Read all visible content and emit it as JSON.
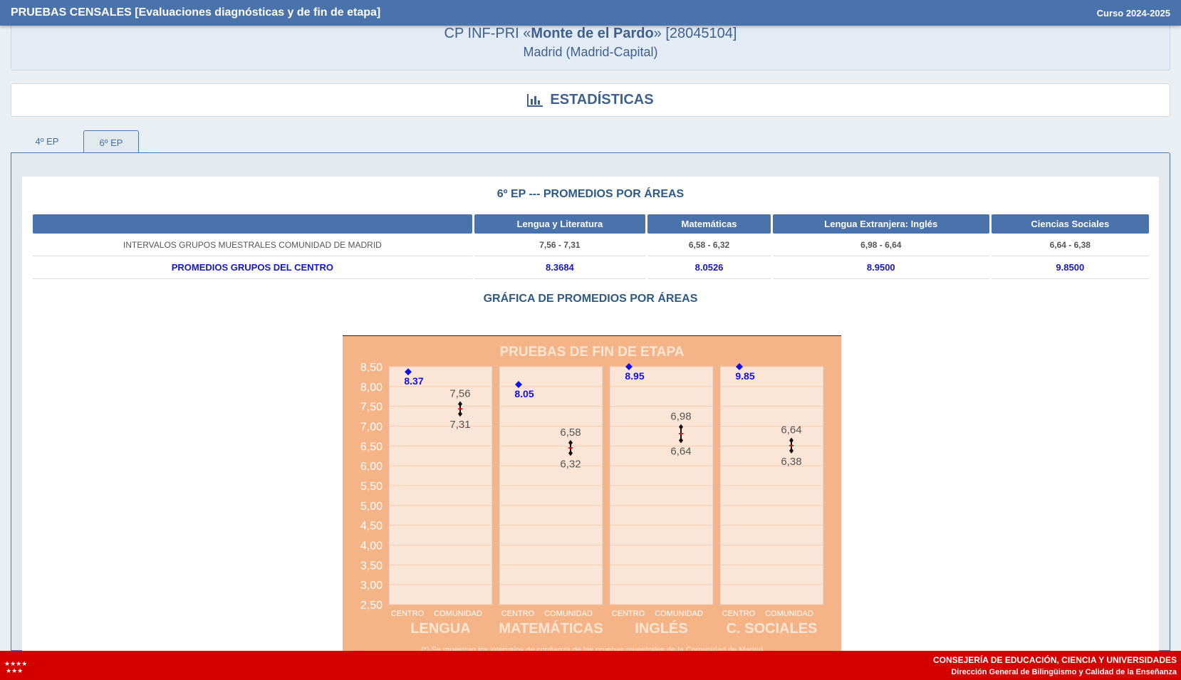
{
  "topbar": {
    "title": "PRUEBAS CENSALES [Evaluaciones diagnósticas y de fin de etapa]",
    "course": "Curso 2024-2025"
  },
  "school": {
    "prefix": "CP INF-PRI «",
    "name": "Monte de el Pardo",
    "suffix": "» [28045104]",
    "location": "Madrid (Madrid-Capital)"
  },
  "stats": {
    "title": "ESTADÍSTICAS",
    "icon": "bar-chart-icon"
  },
  "tabs": [
    {
      "label": "4º EP",
      "active": false
    },
    {
      "label": "6º EP",
      "active": true
    }
  ],
  "table": {
    "title": "6º EP --- PROMEDIOS POR ÁREAS",
    "headers": [
      "",
      "Lengua y Literatura",
      "Matemáticas",
      "Lengua Extranjera: Inglés",
      "Ciencias Sociales"
    ],
    "rows": [
      {
        "label": "INTERVALOS GRUPOS MUESTRALES COMUNIDAD DE MADRID",
        "values": [
          "7,56 - 7,31",
          "6,58 - 6,32",
          "6,98 - 6,64",
          "6,64 - 6,38"
        ]
      },
      {
        "label": "PROMEDIOS GRUPOS DEL CENTRO",
        "values": [
          "8.3684",
          "8.0526",
          "8.9500",
          "9.8500"
        ]
      }
    ]
  },
  "chart_section_title": "GRÁFICA DE PROMEDIOS POR ÁREAS",
  "chart_data": {
    "type": "scatter",
    "title": "PRUEBAS DE FIN DE ETAPA",
    "ylim": [
      2.5,
      8.5
    ],
    "yticks": [
      "8,50",
      "8,00",
      "7,50",
      "7,00",
      "6,50",
      "6,00",
      "5,50",
      "5,00",
      "4,50",
      "4,00",
      "3,50",
      "3,00",
      "2,50"
    ],
    "sub_labels": [
      "CENTRO",
      "COMUNIDAD"
    ],
    "areas": [
      {
        "name": "LENGUA",
        "centro": 8.37,
        "centro_label": "8.37",
        "hi": 7.56,
        "lo": 7.31,
        "hi_label": "7,56",
        "lo_label": "7,31"
      },
      {
        "name": "MATEMÁTICAS",
        "centro": 8.05,
        "centro_label": "8.05",
        "hi": 6.58,
        "lo": 6.32,
        "hi_label": "6,58",
        "lo_label": "6,32"
      },
      {
        "name": "INGLÉS",
        "centro": 8.5,
        "centro_label": "8.95",
        "hi": 6.98,
        "lo": 6.64,
        "hi_label": "6,98",
        "lo_label": "6,64"
      },
      {
        "name": "C. SOCIALES",
        "centro": 8.5,
        "centro_label": "9.85",
        "hi": 6.64,
        "lo": 6.38,
        "hi_label": "6,64",
        "lo_label": "6,38"
      }
    ],
    "footnote": "(*) Se muestran los intervalos de confianza de las pruebas muestrales de la Comunidad de Madrid",
    "colors": {
      "background": "#f5b488",
      "panel": "#fbe5d6",
      "centro": "#1010ee",
      "interval": "#111111",
      "midpoint": "#ee1111",
      "title": "#fde6d4"
    }
  },
  "footer": {
    "line1": "CONSEJERÍA DE EDUCACIÓN, CIENCIA Y UNIVERSIDADES",
    "line2": "Dirección General de Bilingüismo y Calidad de la Enseñanza",
    "color": "#d40000"
  }
}
